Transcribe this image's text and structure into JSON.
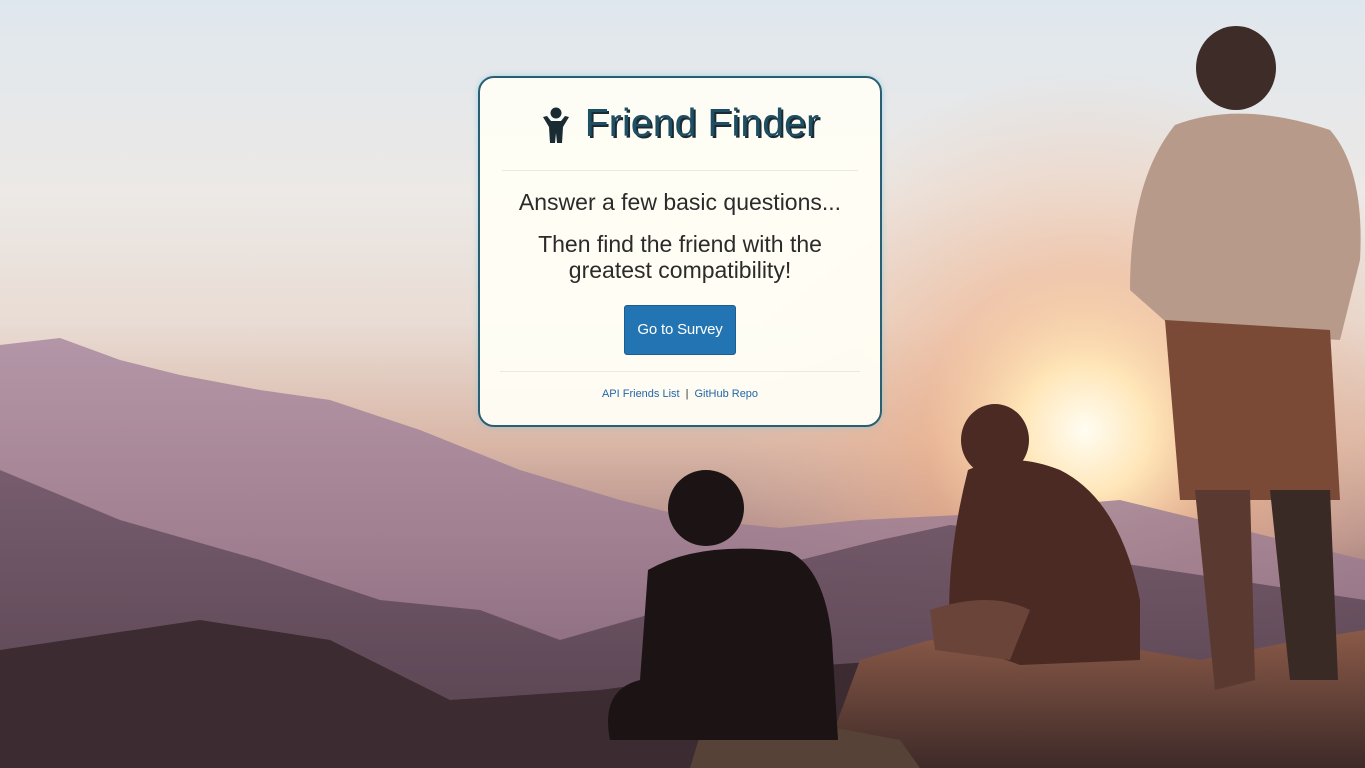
{
  "card": {
    "icon": "person-icon",
    "title": "Friend Finder",
    "line1": "Answer a few basic questions...",
    "line2": "Then find the friend with the greatest compatibility!",
    "button_label": "Go to Survey",
    "links": {
      "api": "API Friends List",
      "separator": "|",
      "github": "GitHub Repo"
    }
  },
  "colors": {
    "title": "#1f4f63",
    "button": "#2374b3",
    "link": "#2466a8",
    "card_border": "#2a5f73"
  }
}
